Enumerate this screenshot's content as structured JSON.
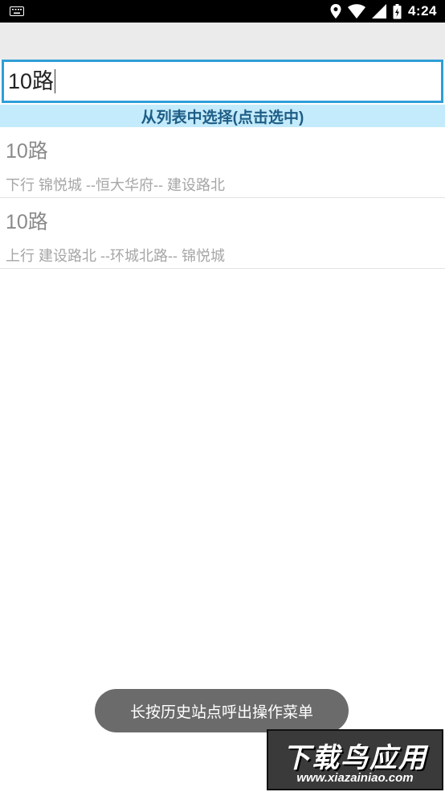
{
  "status_bar": {
    "time": "4:24",
    "icons": [
      "keyboard-icon",
      "location-icon",
      "wifi-icon",
      "signal-icon",
      "battery-icon"
    ]
  },
  "search": {
    "value": "10路"
  },
  "list_header": "从列表中选择(点击选中)",
  "results": [
    {
      "name": "10路",
      "desc": "下行 锦悦城 --恒大华府-- 建设路北"
    },
    {
      "name": "10路",
      "desc": "上行 建设路北 --环城北路-- 锦悦城"
    }
  ],
  "toast": "长按历史站点呼出操作菜单",
  "watermark": {
    "title": "下载鸟应用",
    "url": "www.xiazainiao.com"
  },
  "colors": {
    "accent": "#2f9fd6",
    "header_bg": "#c4ebfb",
    "header_text": "#1d5d86"
  }
}
